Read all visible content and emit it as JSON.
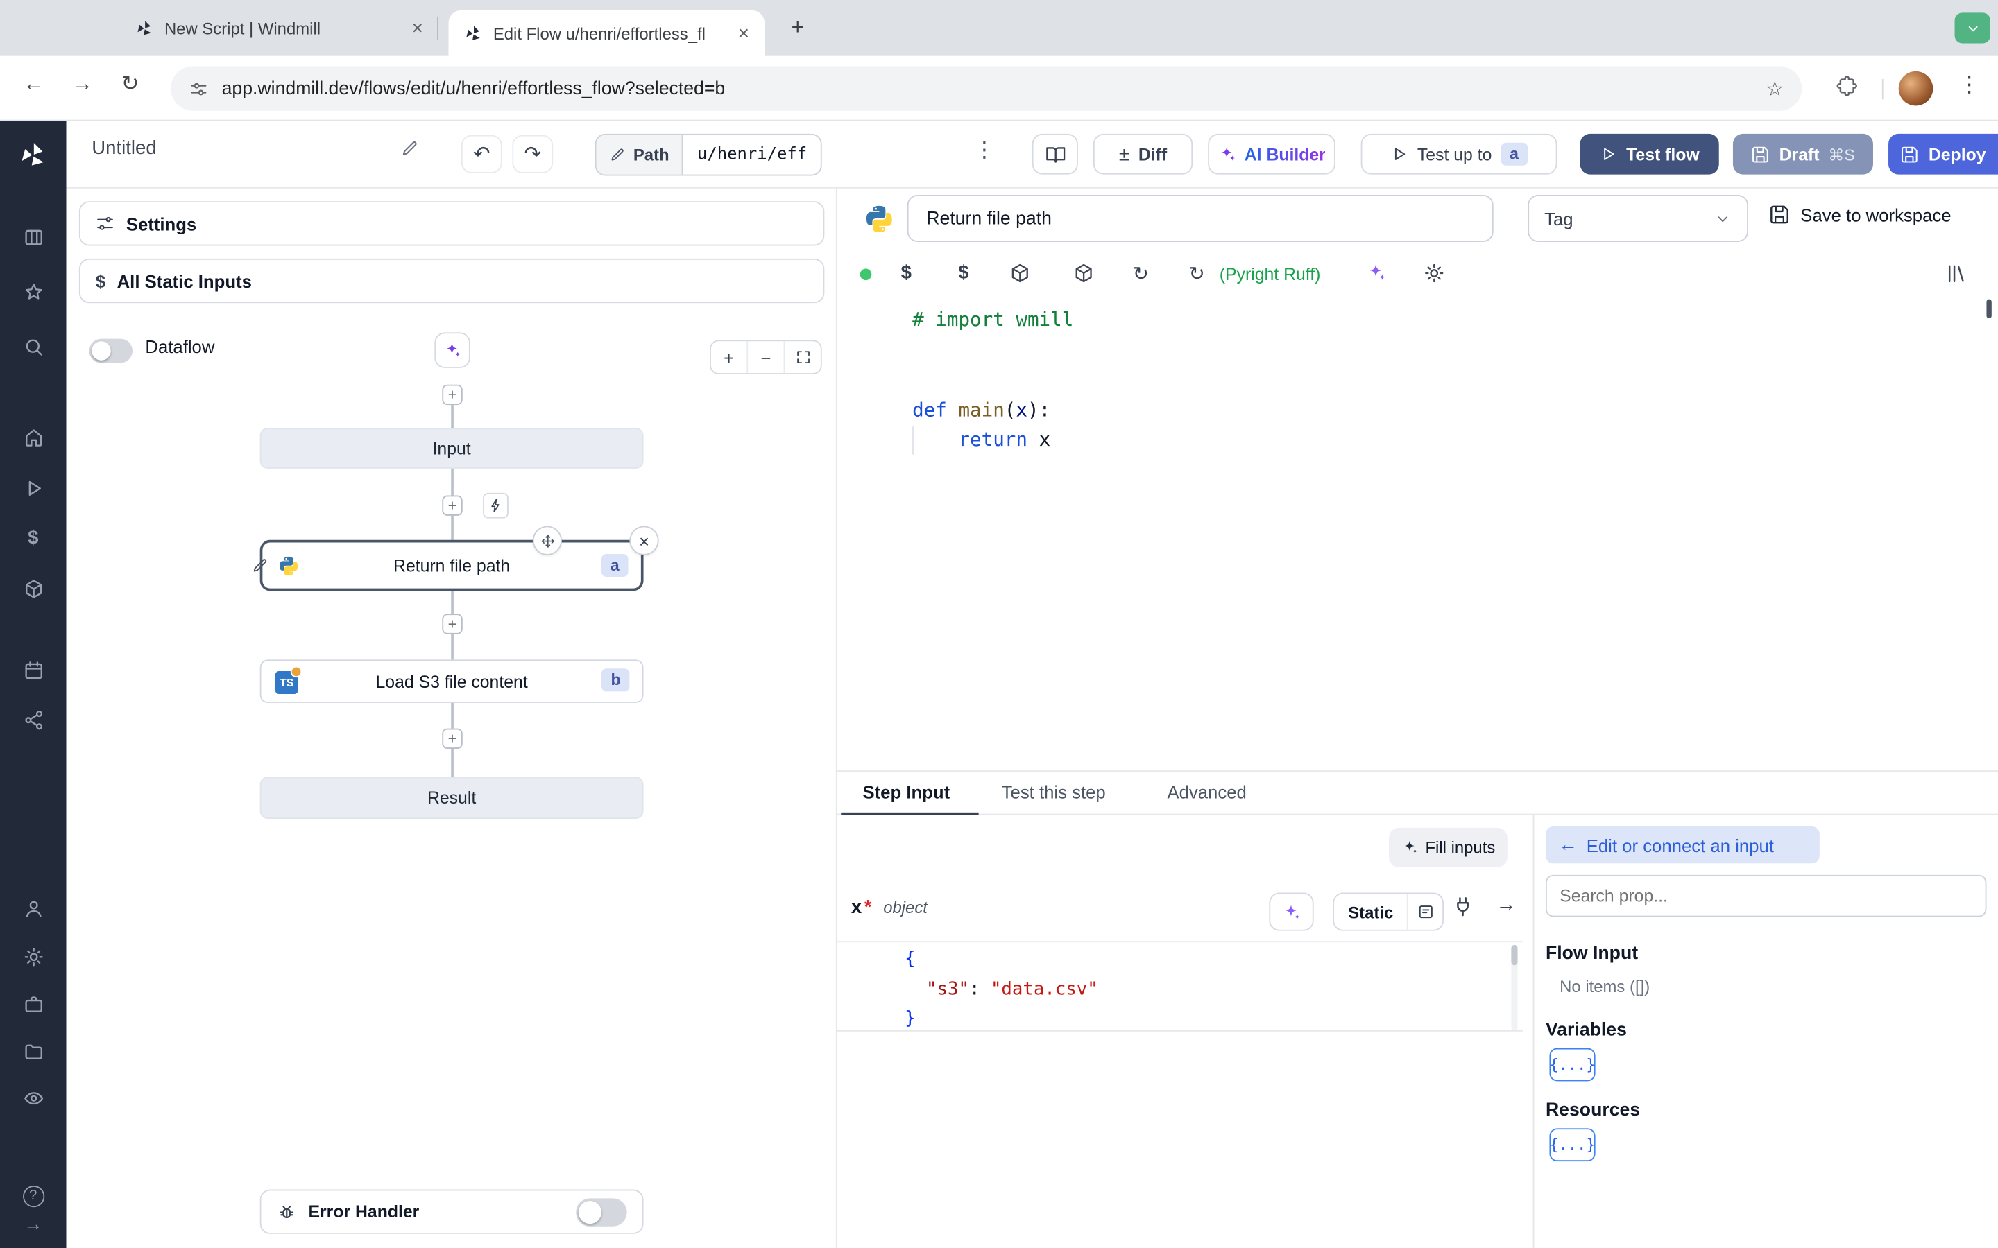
{
  "browser": {
    "tab1_title": "New Script | Windmill",
    "tab2_title": "Edit Flow u/henri/effortless_fl",
    "url": "app.windmill.dev/flows/edit/u/henri/effortless_flow?selected=b"
  },
  "glyphs": {
    "back_arrow": "←",
    "forward_arrow": "→",
    "reload": "↻",
    "bookmark_star": "☆",
    "kebab": "⋮",
    "new_tab": "+",
    "close": "×",
    "undo": "↶",
    "redo": "↷",
    "plus_minus": "±",
    "plus": "+",
    "minus": "−",
    "dollar": "$",
    "right_arrow": "→",
    "left_arrow": "←",
    "question": "?"
  },
  "header": {
    "flow_title": "Untitled",
    "path_label": "Path",
    "path_value": "u/henri/eff",
    "diff_label": "Diff",
    "ai_builder_label": "AI Builder",
    "test_up_to_label": "Test up to",
    "test_up_to_badge": "a",
    "test_flow_label": "Test flow",
    "draft_label": "Draft",
    "draft_shortcut": "⌘S",
    "deploy_label": "Deploy"
  },
  "flow_panel": {
    "settings_label": "Settings",
    "static_inputs_label": "All Static Inputs",
    "dataflow_label": "Dataflow",
    "input_node_label": "Input",
    "step_a_label": "Return file path",
    "step_a_badge": "a",
    "step_b_label": "Load S3 file content",
    "step_b_badge": "b",
    "step_b_icon_text": "TS",
    "result_node_label": "Result",
    "error_handler_label": "Error Handler"
  },
  "step_editor": {
    "name_value": "Return file path",
    "tag_placeholder": "Tag",
    "save_label": "Save to workspace",
    "lint_label": "(Pyright Ruff)",
    "code_lines": [
      [
        {
          "t": "# import wmill",
          "c": "tok-comment"
        }
      ],
      [],
      [],
      [
        {
          "t": "def",
          "c": "tok-kw"
        },
        {
          "t": " ",
          "c": "tok-plain"
        },
        {
          "t": "main",
          "c": "tok-func"
        },
        {
          "t": "(",
          "c": "tok-plain"
        },
        {
          "t": "x",
          "c": "tok-var"
        },
        {
          "t": "):",
          "c": "tok-plain"
        }
      ],
      [
        {
          "t": "    ",
          "c": "tok-plain"
        },
        {
          "t": "return",
          "c": "tok-kw"
        },
        {
          "t": " x",
          "c": "tok-plain"
        }
      ]
    ]
  },
  "step_panel": {
    "tab_step_input": "Step Input",
    "tab_test_step": "Test this step",
    "tab_advanced": "Advanced",
    "fill_inputs_label": "Fill inputs",
    "arg_name": "x",
    "arg_required_mark": "*",
    "arg_type": "object",
    "static_label": "Static",
    "json_lines": [
      [
        {
          "t": "{",
          "c": "tok-brace"
        }
      ],
      [
        {
          "t": "  ",
          "c": "tok-plain"
        },
        {
          "t": "\"s3\"",
          "c": "tok-key"
        },
        {
          "t": ": ",
          "c": "tok-plain"
        },
        {
          "t": "\"data.csv\"",
          "c": "tok-str"
        }
      ],
      [
        {
          "t": "}",
          "c": "tok-brace"
        }
      ]
    ]
  },
  "connect_panel": {
    "back_label": "Edit or connect an input",
    "search_placeholder": "Search prop...",
    "flow_input_label": "Flow Input",
    "flow_input_empty": "No items ([])",
    "variables_label": "Variables",
    "variables_chip": "{...}",
    "resources_label": "Resources",
    "resources_chip": "{...}"
  },
  "colors": {
    "test_flow_navy": "#41527c",
    "draft_slate": "#8594b6",
    "deploy_blue": "#4d66dc",
    "ai_purple": "#7c3aed",
    "lint_green": "#16a34a",
    "status_dot_green": "#3ec76f",
    "selected_border": "#4a5568"
  }
}
